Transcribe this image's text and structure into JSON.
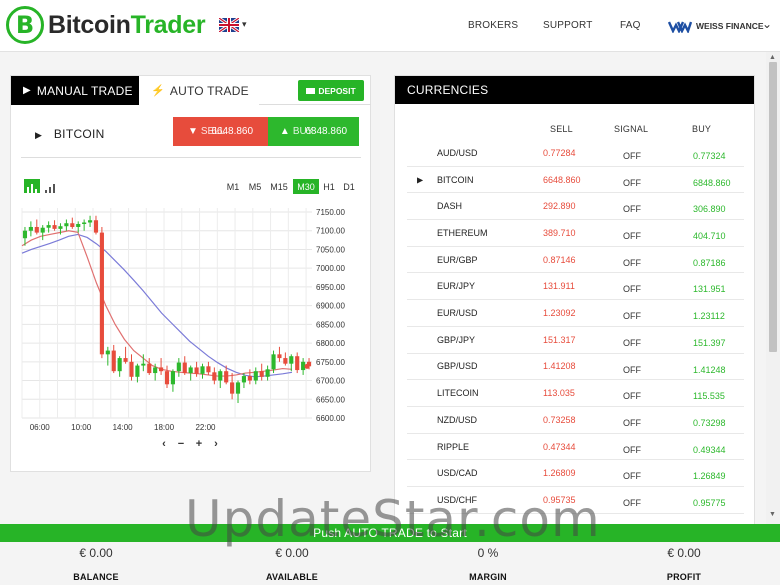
{
  "header": {
    "logo_symbol": "B",
    "logo_word_a": "Bitcoin",
    "logo_word_b": "Trader",
    "nav": [
      "BROKERS",
      "SUPPORT",
      "FAQ"
    ],
    "broker_name": "WEISS FINANCE",
    "brand_green": "#27b427"
  },
  "trade_panel": {
    "tab_manual": "MANUAL TRADE",
    "tab_auto": "AUTO TRADE",
    "deposit_label": "DEPOSIT",
    "asset": "BITCOIN",
    "sell_label": "SELL",
    "sell_price": "6648.860",
    "buy_label": "BUY",
    "buy_price": "6848.860",
    "timeframes": [
      "M1",
      "M5",
      "M15",
      "M30",
      "H1",
      "D1"
    ],
    "active_timeframe": "M30"
  },
  "chart_data": {
    "type": "candlestick",
    "x_ticks": [
      "06:00",
      "10:00",
      "14:00",
      "18:00",
      "22:00"
    ],
    "y_ticks": [
      "7150.00",
      "7100.00",
      "7050.00",
      "7000.00",
      "6950.00",
      "6900.00",
      "6850.00",
      "6800.00",
      "6750.00",
      "6700.00",
      "6650.00",
      "6600.00"
    ],
    "ylim": [
      6600,
      7150
    ],
    "grid": true,
    "candles": [
      [
        7080,
        7110,
        7060,
        7100
      ],
      [
        7100,
        7125,
        7085,
        7110
      ],
      [
        7110,
        7130,
        7090,
        7095
      ],
      [
        7095,
        7115,
        7075,
        7108
      ],
      [
        7108,
        7125,
        7095,
        7115
      ],
      [
        7115,
        7128,
        7100,
        7105
      ],
      [
        7105,
        7120,
        7090,
        7112
      ],
      [
        7112,
        7130,
        7100,
        7120
      ],
      [
        7120,
        7135,
        7105,
        7110
      ],
      [
        7110,
        7125,
        7095,
        7118
      ],
      [
        7118,
        7130,
        7100,
        7122
      ],
      [
        7122,
        7140,
        7110,
        7128
      ],
      [
        7128,
        7140,
        7090,
        7095
      ],
      [
        7095,
        7110,
        6760,
        6770
      ],
      [
        6770,
        6790,
        6740,
        6780
      ],
      [
        6780,
        6795,
        6720,
        6725
      ],
      [
        6725,
        6765,
        6710,
        6760
      ],
      [
        6760,
        6790,
        6745,
        6750
      ],
      [
        6750,
        6770,
        6700,
        6710
      ],
      [
        6710,
        6745,
        6695,
        6740
      ],
      [
        6740,
        6770,
        6725,
        6745
      ],
      [
        6745,
        6760,
        6715,
        6720
      ],
      [
        6720,
        6745,
        6700,
        6735
      ],
      [
        6735,
        6760,
        6715,
        6725
      ],
      [
        6725,
        6740,
        6680,
        6690
      ],
      [
        6690,
        6730,
        6670,
        6725
      ],
      [
        6725,
        6760,
        6710,
        6748
      ],
      [
        6748,
        6765,
        6715,
        6720
      ],
      [
        6720,
        6740,
        6700,
        6735
      ],
      [
        6735,
        6750,
        6710,
        6718
      ],
      [
        6718,
        6745,
        6705,
        6738
      ],
      [
        6738,
        6750,
        6715,
        6722
      ],
      [
        6722,
        6735,
        6690,
        6700
      ],
      [
        6700,
        6730,
        6680,
        6725
      ],
      [
        6725,
        6740,
        6690,
        6695
      ],
      [
        6695,
        6720,
        6650,
        6665
      ],
      [
        6665,
        6700,
        6640,
        6695
      ],
      [
        6695,
        6720,
        6680,
        6712
      ],
      [
        6712,
        6730,
        6690,
        6700
      ],
      [
        6700,
        6735,
        6690,
        6725
      ],
      [
        6725,
        6745,
        6700,
        6710
      ],
      [
        6710,
        6740,
        6700,
        6730
      ],
      [
        6730,
        6780,
        6720,
        6770
      ],
      [
        6770,
        6790,
        6750,
        6760
      ],
      [
        6760,
        6775,
        6740,
        6745
      ],
      [
        6745,
        6770,
        6725,
        6765
      ],
      [
        6765,
        6775,
        6720,
        6728
      ],
      [
        6728,
        6760,
        6715,
        6750
      ],
      [
        6750,
        6760,
        6730,
        6738
      ]
    ],
    "ma_fast": [
      7060,
      7075,
      7085,
      7090,
      7095,
      7100,
      7096,
      7030,
      6960,
      6900,
      6850,
      6810,
      6780,
      6760,
      6740,
      6730,
      6725,
      6722,
      6720,
      6718,
      6715,
      6712,
      6712,
      6715,
      6720,
      6722,
      6725,
      6728,
      6732,
      6730
    ],
    "ma_slow": [
      7040,
      7050,
      7058,
      7066,
      7075,
      7085,
      7090,
      7082,
      7065,
      7045,
      7020,
      6995,
      6968,
      6940,
      6910,
      6880,
      6855,
      6830,
      6805,
      6785,
      6765,
      6748,
      6733,
      6722,
      6714,
      6710,
      6712,
      6715,
      6718,
      6722
    ]
  },
  "currencies": {
    "title": "CURRENCIES",
    "col_sell": "SELL",
    "col_signal": "SIGNAL",
    "col_buy": "BUY",
    "rows": [
      {
        "name": "AUD/USD",
        "sell": "0.77284",
        "signal": "OFF",
        "buy": "0.77324",
        "selected": false
      },
      {
        "name": "BITCOIN",
        "sell": "6648.860",
        "signal": "OFF",
        "buy": "6848.860",
        "selected": true
      },
      {
        "name": "DASH",
        "sell": "292.890",
        "signal": "OFF",
        "buy": "306.890",
        "selected": false
      },
      {
        "name": "ETHEREUM",
        "sell": "389.710",
        "signal": "OFF",
        "buy": "404.710",
        "selected": false
      },
      {
        "name": "EUR/GBP",
        "sell": "0.87146",
        "signal": "OFF",
        "buy": "0.87186",
        "selected": false
      },
      {
        "name": "EUR/JPY",
        "sell": "131.911",
        "signal": "OFF",
        "buy": "131.951",
        "selected": false
      },
      {
        "name": "EUR/USD",
        "sell": "1.23092",
        "signal": "OFF",
        "buy": "1.23112",
        "selected": false
      },
      {
        "name": "GBP/JPY",
        "sell": "151.317",
        "signal": "OFF",
        "buy": "151.397",
        "selected": false
      },
      {
        "name": "GBP/USD",
        "sell": "1.41208",
        "signal": "OFF",
        "buy": "1.41248",
        "selected": false
      },
      {
        "name": "LITECOIN",
        "sell": "113.035",
        "signal": "OFF",
        "buy": "115.535",
        "selected": false
      },
      {
        "name": "NZD/USD",
        "sell": "0.73258",
        "signal": "OFF",
        "buy": "0.73298",
        "selected": false
      },
      {
        "name": "RIPPLE",
        "sell": "0.47344",
        "signal": "OFF",
        "buy": "0.49344",
        "selected": false
      },
      {
        "name": "USD/CAD",
        "sell": "1.26809",
        "signal": "OFF",
        "buy": "1.26849",
        "selected": false
      },
      {
        "name": "USD/CHF",
        "sell": "0.95735",
        "signal": "OFF",
        "buy": "0.95775",
        "selected": false
      }
    ],
    "sell_color": "#e74c3c",
    "buy_color": "#2db82d"
  },
  "push_bar": {
    "label": "Push AUTO TRADE to Start"
  },
  "stats": [
    {
      "value": "€ 0.00",
      "label": "BALANCE"
    },
    {
      "value": "€ 0.00",
      "label": "AVAILABLE"
    },
    {
      "value": "0 %",
      "label": "MARGIN"
    },
    {
      "value": "€ 0.00",
      "label": "PROFIT"
    }
  ],
  "watermark": "UpdateStar.com"
}
